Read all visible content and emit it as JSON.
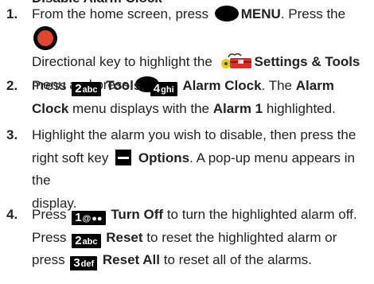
{
  "header": {
    "partial_text": "Disable Alarm Clock"
  },
  "steps": [
    {
      "number": "1.",
      "t1": "From the home screen, press",
      "menu_label": "MENU",
      "t2": ". Press the",
      "t3": "Directional key to highlight the",
      "settings_label": "Settings & Tools",
      "t4": "menu and press",
      "t5": "."
    },
    {
      "number": "2.",
      "t1": "Press",
      "key1_digit": "2",
      "key1_letters": "abc",
      "tools_label": "Tools,",
      "key2_digit": "4",
      "key2_letters": "ghi",
      "alarm_clock_label": "Alarm Clock",
      "t2": ". The",
      "alarm_label": "Alarm",
      "clock_label": "Clock",
      "t3": "menu displays with the",
      "alarm1_label": "Alarm 1",
      "t4": "highlighted."
    },
    {
      "number": "3.",
      "t1": "Highlight the alarm you wish to disable, then press the",
      "t2": "right soft key",
      "options_label": "Options",
      "t3": ". A pop-up menu appears in the",
      "t4": "display."
    },
    {
      "number": "4.",
      "t1": "Press",
      "key1_digit": "1",
      "key1_letters": "@",
      "turn_off_label": "Turn Off",
      "t2": "to turn the highlighted alarm off.",
      "t3": "Press",
      "key2_digit": "2",
      "key2_letters": "abc",
      "reset_label": "Reset",
      "t4": "to reset the highlighted alarm or",
      "t5": "press",
      "key3_digit": "3",
      "key3_letters": "def",
      "reset_all_label": "Reset All",
      "t6": "to reset all of the alarms."
    }
  ],
  "colors": {
    "text": "#222222",
    "key_bg": "#000000",
    "accent_red": "#e2462b",
    "toolbox_red": "#d9302a",
    "toolbox_yellow": "#f2c80f"
  },
  "icons": {
    "menu_button": "oval-key-icon",
    "directional_key": "directional-key-icon",
    "settings_tools": "toolbox-icon",
    "ok_button": "oval-key-icon",
    "right_soft_key": "soft-key-icon"
  }
}
